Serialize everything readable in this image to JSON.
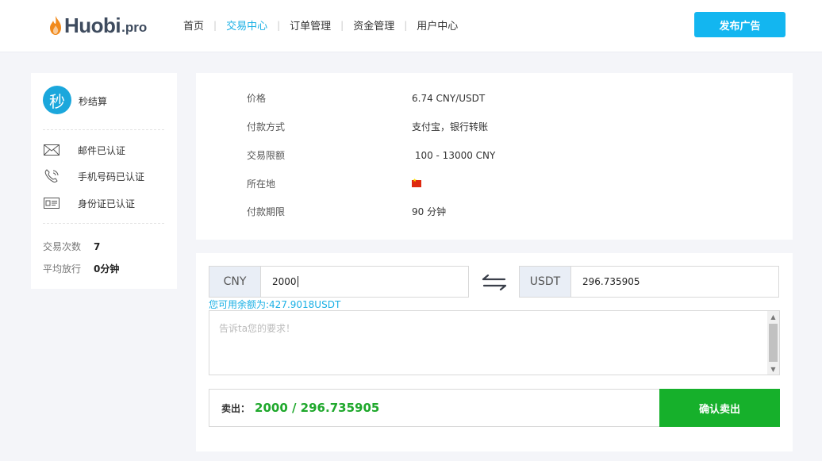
{
  "header": {
    "logo_text": "Huobi",
    "logo_suffix": ".pro",
    "nav": [
      {
        "label": "首页"
      },
      {
        "label": "交易中心"
      },
      {
        "label": "订单管理"
      },
      {
        "label": "资金管理"
      },
      {
        "label": "用户中心"
      }
    ],
    "nav_separator": "|",
    "publish_button": "发布广告"
  },
  "user": {
    "avatar_char": "秒",
    "name": "秒结算",
    "verifications": [
      {
        "label": "邮件已认证",
        "icon": "mail-icon"
      },
      {
        "label": "手机号码已认证",
        "icon": "phone-icon"
      },
      {
        "label": "身份证已认证",
        "icon": "id-card-icon"
      }
    ],
    "stats": [
      {
        "label": "交易次数",
        "value": "7"
      },
      {
        "label": "平均放行",
        "value": "0分钟"
      }
    ]
  },
  "ad_info": {
    "rows": [
      {
        "label": "价格",
        "value": "6.74 CNY/USDT"
      },
      {
        "label": "付款方式",
        "value": "支付宝，银行转账"
      },
      {
        "label": "交易限额",
        "value": " 100 - 13000 CNY"
      },
      {
        "label": "所在地",
        "value": "",
        "icon": "china-flag-icon"
      },
      {
        "label": "付款期限",
        "value": "90 分钟"
      }
    ]
  },
  "trade": {
    "cny_unit": "CNY",
    "cny_value": "2000",
    "usdt_unit": "USDT",
    "usdt_value": "296.735905",
    "swap_icon": "swap-arrows-icon",
    "balance_text": "您可用余额为:427.9018USDT",
    "note_placeholder": "告诉ta您的要求！",
    "sell_label": "卖出：",
    "sell_amount": "2000 / 296.735905",
    "confirm_button": "确认卖出"
  },
  "colors": {
    "accent": "#13b6f0",
    "confirm": "#16b02b",
    "sell_amount": "#1fa82c"
  }
}
